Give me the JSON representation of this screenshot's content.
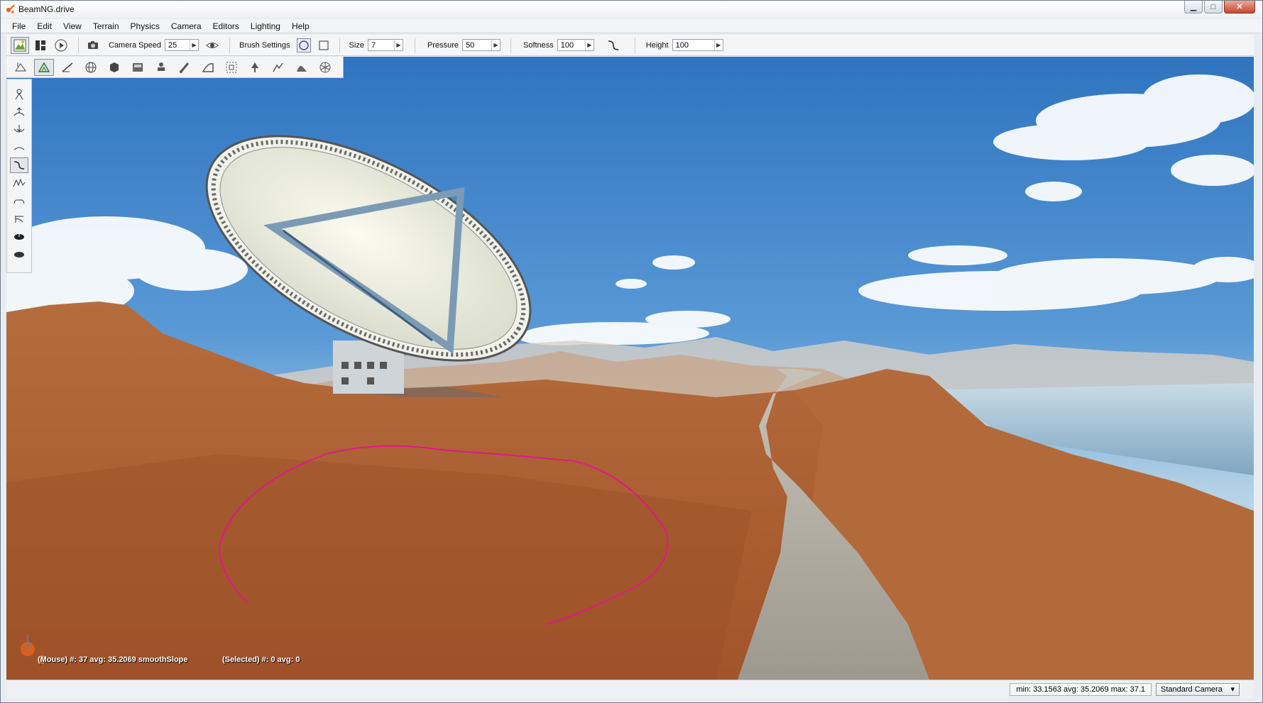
{
  "window": {
    "title": "BeamNG.drive",
    "controls": [
      "minimize",
      "maximize",
      "close"
    ]
  },
  "menubar": {
    "items": [
      "File",
      "Edit",
      "View",
      "Terrain",
      "Physics",
      "Camera",
      "Editors",
      "Lighting",
      "Help"
    ]
  },
  "toolbar": {
    "camera_speed_label": "Camera Speed",
    "camera_speed_value": "25",
    "brush_settings_label": "Brush Settings",
    "size_label": "Size",
    "size_value": "7",
    "pressure_label": "Pressure",
    "pressure_value": "50",
    "softness_label": "Softness",
    "softness_value": "100",
    "height_label": "Height",
    "height_value": "100"
  },
  "terrain_toolbar": {
    "icons": [
      "terrain-select-icon",
      "terrain-brush-icon",
      "measure-icon",
      "globe-icon",
      "cube-icon",
      "material-icon",
      "stamp-icon",
      "paint-icon",
      "ramp-icon",
      "frame-icon",
      "vegetation-icon",
      "sculpt-icon",
      "smooth-icon",
      "mesh-icon"
    ]
  },
  "side_tools": {
    "icons": [
      "select-tool-icon",
      "raise-tool-icon",
      "lower-tool-icon",
      "flatten-tool-icon",
      "smooth-slope-tool-icon",
      "noise-tool-icon",
      "set-height-tool-icon",
      "clear-tool-icon",
      "paint-hole-icon",
      "fill-hole-icon"
    ]
  },
  "viewport": {
    "mouse_info": "(Mouse) #: 37  avg: 35.2069 smoothSlope",
    "selected_info": "(Selected) #: 0  avg: 0"
  },
  "statusbar": {
    "stats": "min: 33.1563  avg: 35.2069  max: 37.1",
    "camera_mode": "Standard Camera"
  },
  "colors": {
    "sky_top": "#3a7fc8",
    "sky_horizon": "#c7dcea",
    "terrain": "#b4693a",
    "brush_outline": "#e0188c",
    "road": "#a9a49b"
  }
}
